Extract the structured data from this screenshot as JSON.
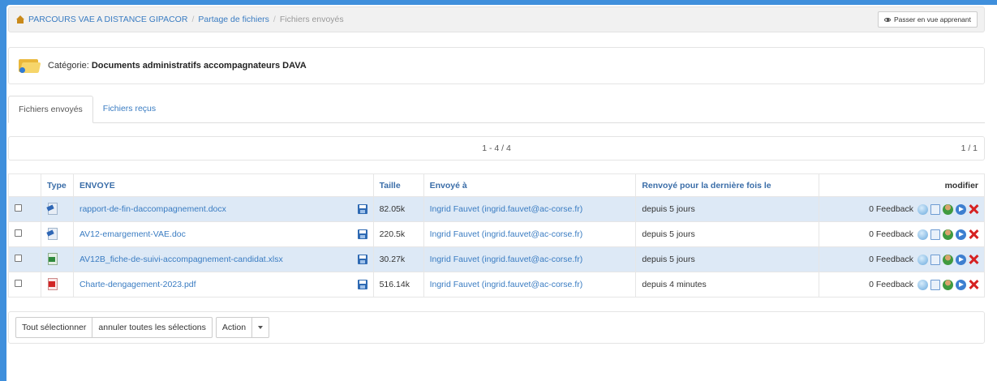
{
  "breadcrumb": {
    "home": "PARCOURS VAE A DISTANCE GIPACOR",
    "section": "Partage de fichiers",
    "current": "Fichiers envoyés"
  },
  "header": {
    "learner_view_button": "Passer en vue apprenant"
  },
  "category": {
    "label": "Catégorie:",
    "name": "Documents administratifs accompagnateurs DAVA"
  },
  "tabs": [
    {
      "label": "Fichiers envoyés",
      "active": true
    },
    {
      "label": "Fichiers reçus",
      "active": false
    }
  ],
  "pagination": {
    "range": "1 - 4 / 4",
    "pages": "1 / 1"
  },
  "table": {
    "columns": {
      "type": "Type",
      "sent": "ENVOYE",
      "size": "Taille",
      "sent_to": "Envoyé à",
      "last_resent": "Renvoyé pour la dernière fois le",
      "modify": "modifier"
    },
    "rows": [
      {
        "icon": "word-doc-icon",
        "name": "rapport-de-fin-daccompagnement.docx",
        "size": "82.05k",
        "to": "Ingrid Fauvet (ingrid.fauvet@ac-corse.fr)",
        "when": "depuis 5 jours",
        "feedback": "0 Feedback"
      },
      {
        "icon": "word-doc-icon",
        "name": "AV12-emargement-VAE.doc",
        "size": "220.5k",
        "to": "Ingrid Fauvet (ingrid.fauvet@ac-corse.fr)",
        "when": "depuis 5 jours",
        "feedback": "0 Feedback"
      },
      {
        "icon": "excel-icon",
        "name": "AV12B_fiche-de-suivi-accompagnement-candidat.xlsx",
        "size": "30.27k",
        "to": "Ingrid Fauvet (ingrid.fauvet@ac-corse.fr)",
        "when": "depuis 5 jours",
        "feedback": "0 Feedback"
      },
      {
        "icon": "pdf-icon",
        "name": "Charte-dengagement-2023.pdf",
        "size": "516.14k",
        "to": "Ingrid Fauvet (ingrid.fauvet@ac-corse.fr)",
        "when": "depuis 4 minutes",
        "feedback": "0 Feedback"
      }
    ]
  },
  "bulk": {
    "select_all": "Tout sélectionner",
    "unselect_all": "annuler toutes les sélections",
    "action": "Action"
  },
  "colors": {
    "link": "#3a7cc2",
    "row_highlight": "#dde9f6",
    "background_edge": "#3f8fdc"
  }
}
